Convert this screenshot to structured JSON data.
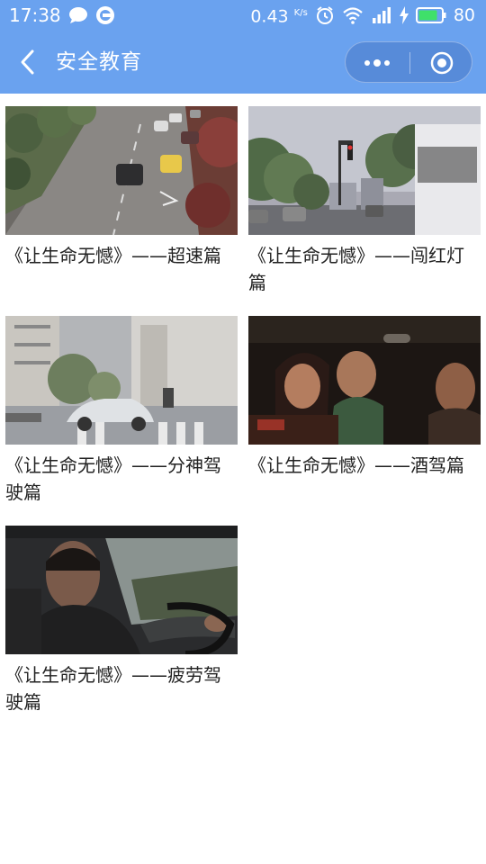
{
  "status_bar": {
    "time": "17:38",
    "speed_value": "0.43",
    "speed_unit": "K/s",
    "battery": "80",
    "icons": [
      "chat-bubble-icon",
      "app-notification-icon",
      "alarm-icon",
      "wifi-icon",
      "signal-4g-icon",
      "charging-icon",
      "battery-icon"
    ],
    "battery_color": "#3fe06a"
  },
  "nav": {
    "title": "安全教育",
    "back_icon": "chevron-left-icon",
    "more_icon": "more-dots-icon",
    "close_icon": "target-close-icon"
  },
  "theme": {
    "nav_background": "#6aa2ef",
    "text_color": "#222222"
  },
  "videos": [
    {
      "title": "《让生命无憾》——超速篇",
      "thumbnail": "highway-traffic-thumbnail"
    },
    {
      "title": "《让生命无憾》——闯红灯篇",
      "thumbnail": "red-light-intersection-thumbnail"
    },
    {
      "title": "《让生命无憾》——分神驾驶篇",
      "thumbnail": "car-crosswalk-thumbnail"
    },
    {
      "title": "《让生命无憾》——酒驾篇",
      "thumbnail": "drunk-passengers-thumbnail"
    },
    {
      "title": "《让生命无憾》——疲劳驾驶篇",
      "thumbnail": "tired-driver-thumbnail"
    }
  ]
}
